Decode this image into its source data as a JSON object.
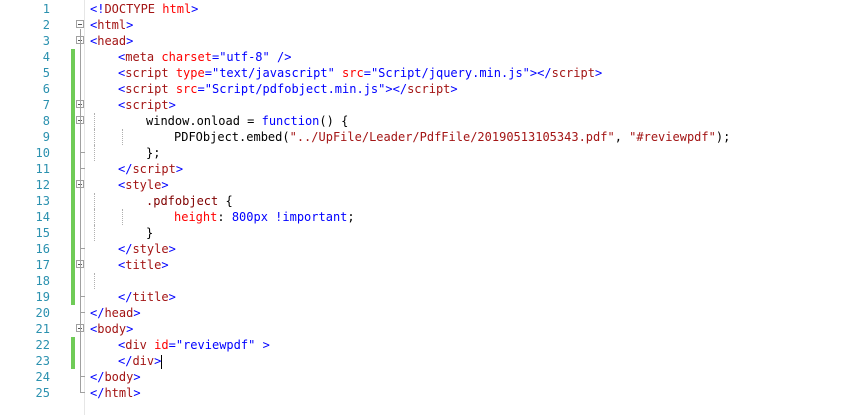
{
  "editor": {
    "line_numbers": [
      "1",
      "2",
      "3",
      "4",
      "5",
      "6",
      "7",
      "8",
      "9",
      "10",
      "11",
      "12",
      "13",
      "14",
      "15",
      "16",
      "17",
      "18",
      "19",
      "20",
      "21",
      "22",
      "23",
      "24",
      "25"
    ],
    "lines": [
      {
        "indent": 0,
        "tokens": [
          {
            "c": "br",
            "t": "<!"
          },
          {
            "c": "tag",
            "t": "DOCTYPE"
          },
          {
            "c": "plain",
            "t": " "
          },
          {
            "c": "attr",
            "t": "html"
          },
          {
            "c": "br",
            "t": ">"
          }
        ]
      },
      {
        "indent": 0,
        "tokens": [
          {
            "c": "br",
            "t": "<"
          },
          {
            "c": "tag",
            "t": "html"
          },
          {
            "c": "br",
            "t": ">"
          }
        ]
      },
      {
        "indent": 0,
        "tokens": [
          {
            "c": "br",
            "t": "<"
          },
          {
            "c": "tag",
            "t": "head"
          },
          {
            "c": "br",
            "t": ">"
          }
        ]
      },
      {
        "indent": 1,
        "tokens": [
          {
            "c": "br",
            "t": "<"
          },
          {
            "c": "tag",
            "t": "meta"
          },
          {
            "c": "plain",
            "t": " "
          },
          {
            "c": "attr",
            "t": "charset"
          },
          {
            "c": "br",
            "t": "="
          },
          {
            "c": "val",
            "t": "\"utf-8\""
          },
          {
            "c": "plain",
            "t": " "
          },
          {
            "c": "br",
            "t": "/>"
          }
        ]
      },
      {
        "indent": 1,
        "tokens": [
          {
            "c": "br",
            "t": "<"
          },
          {
            "c": "tag",
            "t": "script"
          },
          {
            "c": "plain",
            "t": " "
          },
          {
            "c": "attr",
            "t": "type"
          },
          {
            "c": "br",
            "t": "="
          },
          {
            "c": "val",
            "t": "\"text/javascript\""
          },
          {
            "c": "plain",
            "t": " "
          },
          {
            "c": "attr",
            "t": "src"
          },
          {
            "c": "br",
            "t": "="
          },
          {
            "c": "val",
            "t": "\"Script/jquery.min.js\""
          },
          {
            "c": "br",
            "t": "></"
          },
          {
            "c": "tag",
            "t": "script"
          },
          {
            "c": "br",
            "t": ">"
          }
        ]
      },
      {
        "indent": 1,
        "tokens": [
          {
            "c": "br",
            "t": "<"
          },
          {
            "c": "tag",
            "t": "script"
          },
          {
            "c": "plain",
            "t": " "
          },
          {
            "c": "attr",
            "t": "src"
          },
          {
            "c": "br",
            "t": "="
          },
          {
            "c": "val",
            "t": "\"Script/pdfobject.min.js\""
          },
          {
            "c": "br",
            "t": "></"
          },
          {
            "c": "tag",
            "t": "script"
          },
          {
            "c": "br",
            "t": ">"
          }
        ]
      },
      {
        "indent": 1,
        "tokens": [
          {
            "c": "br",
            "t": "<"
          },
          {
            "c": "tag",
            "t": "script"
          },
          {
            "c": "br",
            "t": ">"
          }
        ]
      },
      {
        "indent": 2,
        "tokens": [
          {
            "c": "plain",
            "t": "window.onload = "
          },
          {
            "c": "kw",
            "t": "function"
          },
          {
            "c": "plain",
            "t": "() {"
          }
        ]
      },
      {
        "indent": 3,
        "tokens": [
          {
            "c": "plain",
            "t": "PDFObject.embed("
          },
          {
            "c": "str",
            "t": "\"../UpFile/Leader/PdfFile/20190513105343.pdf\""
          },
          {
            "c": "plain",
            "t": ", "
          },
          {
            "c": "str",
            "t": "\"#reviewpdf\""
          },
          {
            "c": "plain",
            "t": ");"
          }
        ]
      },
      {
        "indent": 2,
        "tokens": [
          {
            "c": "plain",
            "t": "};"
          }
        ]
      },
      {
        "indent": 1,
        "tokens": [
          {
            "c": "br",
            "t": "</"
          },
          {
            "c": "tag",
            "t": "script"
          },
          {
            "c": "br",
            "t": ">"
          }
        ]
      },
      {
        "indent": 1,
        "tokens": [
          {
            "c": "br",
            "t": "<"
          },
          {
            "c": "tag",
            "t": "style"
          },
          {
            "c": "br",
            "t": ">"
          }
        ]
      },
      {
        "indent": 2,
        "tokens": [
          {
            "c": "css-sel",
            "t": ".pdfobject"
          },
          {
            "c": "plain",
            "t": " {"
          }
        ]
      },
      {
        "indent": 3,
        "tokens": [
          {
            "c": "css-prop",
            "t": "height"
          },
          {
            "c": "plain",
            "t": ": "
          },
          {
            "c": "css-val",
            "t": "800px !important"
          },
          {
            "c": "plain",
            "t": ";"
          }
        ]
      },
      {
        "indent": 2,
        "tokens": [
          {
            "c": "plain",
            "t": "}"
          }
        ]
      },
      {
        "indent": 1,
        "tokens": [
          {
            "c": "br",
            "t": "</"
          },
          {
            "c": "tag",
            "t": "style"
          },
          {
            "c": "br",
            "t": ">"
          }
        ]
      },
      {
        "indent": 1,
        "tokens": [
          {
            "c": "br",
            "t": "<"
          },
          {
            "c": "tag",
            "t": "title"
          },
          {
            "c": "br",
            "t": ">"
          }
        ]
      },
      {
        "indent": 1,
        "tokens": []
      },
      {
        "indent": 1,
        "tokens": [
          {
            "c": "br",
            "t": "</"
          },
          {
            "c": "tag",
            "t": "title"
          },
          {
            "c": "br",
            "t": ">"
          }
        ]
      },
      {
        "indent": 0,
        "tokens": [
          {
            "c": "br",
            "t": "</"
          },
          {
            "c": "tag",
            "t": "head"
          },
          {
            "c": "br",
            "t": ">"
          }
        ]
      },
      {
        "indent": 0,
        "tokens": [
          {
            "c": "br",
            "t": "<"
          },
          {
            "c": "tag",
            "t": "body"
          },
          {
            "c": "br",
            "t": ">"
          }
        ]
      },
      {
        "indent": 1,
        "tokens": [
          {
            "c": "br",
            "t": "<"
          },
          {
            "c": "tag",
            "t": "div"
          },
          {
            "c": "plain",
            "t": " "
          },
          {
            "c": "attr",
            "t": "id"
          },
          {
            "c": "br",
            "t": "="
          },
          {
            "c": "val",
            "t": "\"reviewpdf\""
          },
          {
            "c": "plain",
            "t": " "
          },
          {
            "c": "br",
            "t": ">"
          }
        ]
      },
      {
        "indent": 1,
        "tokens": [
          {
            "c": "br",
            "t": "</"
          },
          {
            "c": "tag",
            "t": "div"
          },
          {
            "c": "br",
            "t": ">"
          }
        ],
        "caret": true
      },
      {
        "indent": 0,
        "tokens": [
          {
            "c": "br",
            "t": "</"
          },
          {
            "c": "tag",
            "t": "body"
          },
          {
            "c": "br",
            "t": ">"
          }
        ]
      },
      {
        "indent": 0,
        "tokens": [
          {
            "c": "br",
            "t": "</"
          },
          {
            "c": "tag",
            "t": "html"
          },
          {
            "c": "br",
            "t": ">"
          }
        ]
      }
    ],
    "changed_lines": [
      4,
      5,
      6,
      7,
      8,
      9,
      10,
      11,
      12,
      13,
      14,
      15,
      16,
      17,
      18,
      19,
      22,
      23
    ],
    "fold_starts": [
      2,
      3,
      7,
      8,
      12,
      17,
      21
    ],
    "colors": {
      "line_number": "#2b91af",
      "tag": "#a31515",
      "bracket": "#0000ff",
      "attribute": "#ff0000",
      "value": "#0000ff",
      "change_marker": "#6fcb57"
    }
  }
}
